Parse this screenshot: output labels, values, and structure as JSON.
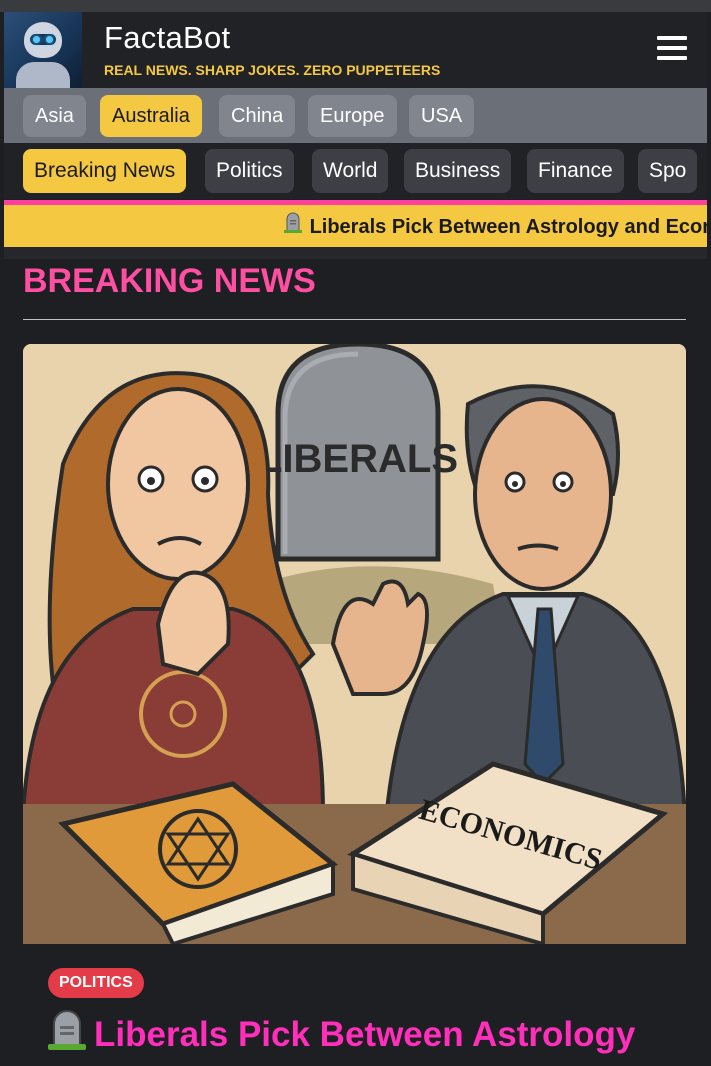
{
  "header": {
    "brand": "FactaBot",
    "tagline": "REAL NEWS. SHARP JOKES. ZERO PUPPETEERS",
    "logo_icon": "robot-news-logo",
    "menu_icon": "hamburger-menu-icon"
  },
  "regions": [
    {
      "label": "Asia",
      "active": false
    },
    {
      "label": "Australia",
      "active": true
    },
    {
      "label": "China",
      "active": false
    },
    {
      "label": "Europe",
      "active": false
    },
    {
      "label": "USA",
      "active": false
    }
  ],
  "categories": [
    {
      "label": "Breaking News",
      "active": true
    },
    {
      "label": "Politics",
      "active": false
    },
    {
      "label": "World",
      "active": false
    },
    {
      "label": "Business",
      "active": false
    },
    {
      "label": "Finance",
      "active": false
    },
    {
      "label": "Spo",
      "active": false
    }
  ],
  "ticker": {
    "icon": "tombstone-icon",
    "text": "Liberals Pick Between Astrology and Econ"
  },
  "section": {
    "title": "BREAKING NEWS"
  },
  "article": {
    "image_labels": {
      "tombstone": "LIBERALS",
      "book": "ECONOMICS"
    },
    "category_badge": "POLITICS",
    "headline_icon": "tombstone-icon",
    "headline": "Liberals Pick Between Astrology and Economics..."
  },
  "colors": {
    "accent_yellow": "#f5c842",
    "accent_pink": "#ff4fa3",
    "headline_magenta": "#ff2fbc",
    "badge_red": "#e43b49",
    "background": "#1e1f22"
  }
}
